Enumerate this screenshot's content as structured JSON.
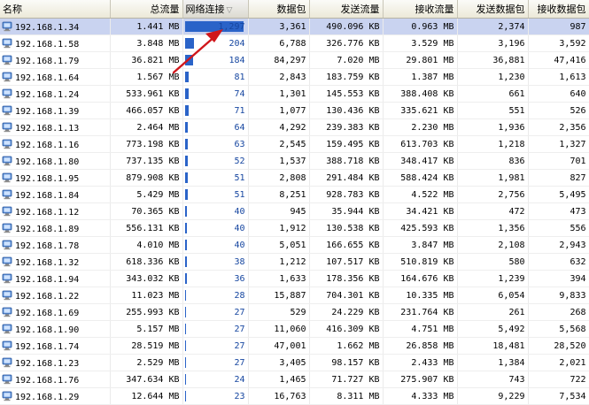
{
  "columns": [
    "名称",
    "总流量",
    "网络连接",
    "数据包",
    "发送流量",
    "接收流量",
    "发送数据包",
    "接收数据包"
  ],
  "sort_indicator": "▽",
  "max_connections": 1297,
  "rows": [
    {
      "name": "192.168.1.34",
      "total": "1.441 MB",
      "conn": "1,297",
      "conn_value": 1297,
      "packets": "3,361",
      "sent": "490.096 KB",
      "recv": "0.963 MB",
      "sent_pk": "2,374",
      "recv_pk": "987",
      "selected": true
    },
    {
      "name": "192.168.1.58",
      "total": "3.848 MB",
      "conn": "204",
      "conn_value": 204,
      "packets": "6,788",
      "sent": "326.776 KB",
      "recv": "3.529 MB",
      "sent_pk": "3,196",
      "recv_pk": "3,592"
    },
    {
      "name": "192.168.1.79",
      "total": "36.821 MB",
      "conn": "184",
      "conn_value": 184,
      "packets": "84,297",
      "sent": "7.020 MB",
      "recv": "29.801 MB",
      "sent_pk": "36,881",
      "recv_pk": "47,416"
    },
    {
      "name": "192.168.1.64",
      "total": "1.567 MB",
      "conn": "81",
      "conn_value": 81,
      "packets": "2,843",
      "sent": "183.759 KB",
      "recv": "1.387 MB",
      "sent_pk": "1,230",
      "recv_pk": "1,613"
    },
    {
      "name": "192.168.1.24",
      "total": "533.961 KB",
      "conn": "74",
      "conn_value": 74,
      "packets": "1,301",
      "sent": "145.553 KB",
      "recv": "388.408 KB",
      "sent_pk": "661",
      "recv_pk": "640"
    },
    {
      "name": "192.168.1.39",
      "total": "466.057 KB",
      "conn": "71",
      "conn_value": 71,
      "packets": "1,077",
      "sent": "130.436 KB",
      "recv": "335.621 KB",
      "sent_pk": "551",
      "recv_pk": "526"
    },
    {
      "name": "192.168.1.13",
      "total": "2.464 MB",
      "conn": "64",
      "conn_value": 64,
      "packets": "4,292",
      "sent": "239.383 KB",
      "recv": "2.230 MB",
      "sent_pk": "1,936",
      "recv_pk": "2,356"
    },
    {
      "name": "192.168.1.16",
      "total": "773.198 KB",
      "conn": "63",
      "conn_value": 63,
      "packets": "2,545",
      "sent": "159.495 KB",
      "recv": "613.703 KB",
      "sent_pk": "1,218",
      "recv_pk": "1,327"
    },
    {
      "name": "192.168.1.80",
      "total": "737.135 KB",
      "conn": "52",
      "conn_value": 52,
      "packets": "1,537",
      "sent": "388.718 KB",
      "recv": "348.417 KB",
      "sent_pk": "836",
      "recv_pk": "701"
    },
    {
      "name": "192.168.1.95",
      "total": "879.908 KB",
      "conn": "51",
      "conn_value": 51,
      "packets": "2,808",
      "sent": "291.484 KB",
      "recv": "588.424 KB",
      "sent_pk": "1,981",
      "recv_pk": "827"
    },
    {
      "name": "192.168.1.84",
      "total": "5.429 MB",
      "conn": "51",
      "conn_value": 51,
      "packets": "8,251",
      "sent": "928.783 KB",
      "recv": "4.522 MB",
      "sent_pk": "2,756",
      "recv_pk": "5,495"
    },
    {
      "name": "192.168.1.12",
      "total": "70.365 KB",
      "conn": "40",
      "conn_value": 40,
      "packets": "945",
      "sent": "35.944 KB",
      "recv": "34.421 KB",
      "sent_pk": "472",
      "recv_pk": "473"
    },
    {
      "name": "192.168.1.89",
      "total": "556.131 KB",
      "conn": "40",
      "conn_value": 40,
      "packets": "1,912",
      "sent": "130.538 KB",
      "recv": "425.593 KB",
      "sent_pk": "1,356",
      "recv_pk": "556"
    },
    {
      "name": "192.168.1.78",
      "total": "4.010 MB",
      "conn": "40",
      "conn_value": 40,
      "packets": "5,051",
      "sent": "166.655 KB",
      "recv": "3.847 MB",
      "sent_pk": "2,108",
      "recv_pk": "2,943"
    },
    {
      "name": "192.168.1.32",
      "total": "618.336 KB",
      "conn": "38",
      "conn_value": 38,
      "packets": "1,212",
      "sent": "107.517 KB",
      "recv": "510.819 KB",
      "sent_pk": "580",
      "recv_pk": "632"
    },
    {
      "name": "192.168.1.94",
      "total": "343.032 KB",
      "conn": "36",
      "conn_value": 36,
      "packets": "1,633",
      "sent": "178.356 KB",
      "recv": "164.676 KB",
      "sent_pk": "1,239",
      "recv_pk": "394"
    },
    {
      "name": "192.168.1.22",
      "total": "11.023 MB",
      "conn": "28",
      "conn_value": 28,
      "packets": "15,887",
      "sent": "704.301 KB",
      "recv": "10.335 MB",
      "sent_pk": "6,054",
      "recv_pk": "9,833"
    },
    {
      "name": "192.168.1.69",
      "total": "255.993 KB",
      "conn": "27",
      "conn_value": 27,
      "packets": "529",
      "sent": "24.229 KB",
      "recv": "231.764 KB",
      "sent_pk": "261",
      "recv_pk": "268"
    },
    {
      "name": "192.168.1.90",
      "total": "5.157 MB",
      "conn": "27",
      "conn_value": 27,
      "packets": "11,060",
      "sent": "416.309 KB",
      "recv": "4.751 MB",
      "sent_pk": "5,492",
      "recv_pk": "5,568"
    },
    {
      "name": "192.168.1.74",
      "total": "28.519 MB",
      "conn": "27",
      "conn_value": 27,
      "packets": "47,001",
      "sent": "1.662 MB",
      "recv": "26.858 MB",
      "sent_pk": "18,481",
      "recv_pk": "28,520"
    },
    {
      "name": "192.168.1.23",
      "total": "2.529 MB",
      "conn": "27",
      "conn_value": 27,
      "packets": "3,405",
      "sent": "98.157 KB",
      "recv": "2.433 MB",
      "sent_pk": "1,384",
      "recv_pk": "2,021"
    },
    {
      "name": "192.168.1.76",
      "total": "347.634 KB",
      "conn": "24",
      "conn_value": 24,
      "packets": "1,465",
      "sent": "71.727 KB",
      "recv": "275.907 KB",
      "sent_pk": "743",
      "recv_pk": "722"
    },
    {
      "name": "192.168.1.29",
      "total": "12.644 MB",
      "conn": "23",
      "conn_value": 23,
      "packets": "16,763",
      "sent": "8.311 MB",
      "recv": "4.333 MB",
      "sent_pk": "9,229",
      "recv_pk": "7,534"
    }
  ],
  "colors": {
    "bar": "#2a63c8",
    "selected_row": "#c9d3f0",
    "annotation_arrow": "#d0161b"
  },
  "icons": {
    "row_icon": "computer-icon",
    "annotation": "red-arrow-annotation"
  }
}
